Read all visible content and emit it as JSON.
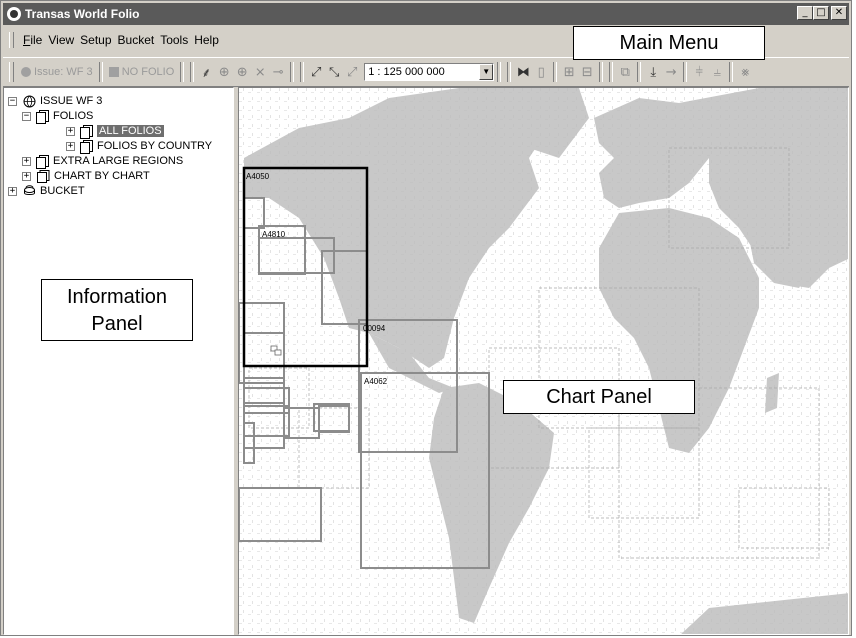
{
  "window": {
    "title": "Transas World Folio",
    "controls": [
      "minimize-icon",
      "maximize-icon",
      "close-icon"
    ]
  },
  "menu": {
    "items": [
      {
        "label": "File",
        "accel": "F"
      },
      {
        "label": "View"
      },
      {
        "label": "Setup"
      },
      {
        "label": "Bucket"
      },
      {
        "label": "Tools"
      },
      {
        "label": "Help"
      }
    ]
  },
  "toolbar": {
    "issue_label": "Issue: WF 3",
    "folio_label": "NO FOLIO",
    "scale_value": "1 : 125 000 000"
  },
  "tree": {
    "items": [
      {
        "label": "ISSUE WF 3",
        "icon": "globe-icon",
        "expander": "minus"
      },
      {
        "label": "FOLIOS",
        "icon": "folio-icon",
        "expander": "minus"
      },
      {
        "label": "ALL FOLIOS",
        "icon": "folio-icon",
        "expander": "plus",
        "selected": true
      },
      {
        "label": "FOLIOS BY COUNTRY",
        "icon": "folio-icon",
        "expander": "plus"
      },
      {
        "label": "EXTRA LARGE REGIONS",
        "icon": "folio-icon",
        "expander": "plus"
      },
      {
        "label": "CHART BY CHART",
        "icon": "chart-icon",
        "expander": "plus"
      },
      {
        "label": "BUCKET",
        "icon": "bucket-icon",
        "expander": "plus"
      }
    ]
  },
  "chart_labels": {
    "c1": "A4050",
    "c2": "A4810",
    "c3": "00094",
    "c4": "A4062"
  },
  "callouts": {
    "main_menu": "Main Menu",
    "info_panel": "Information\nPanel",
    "chart_panel": "Chart Panel"
  }
}
